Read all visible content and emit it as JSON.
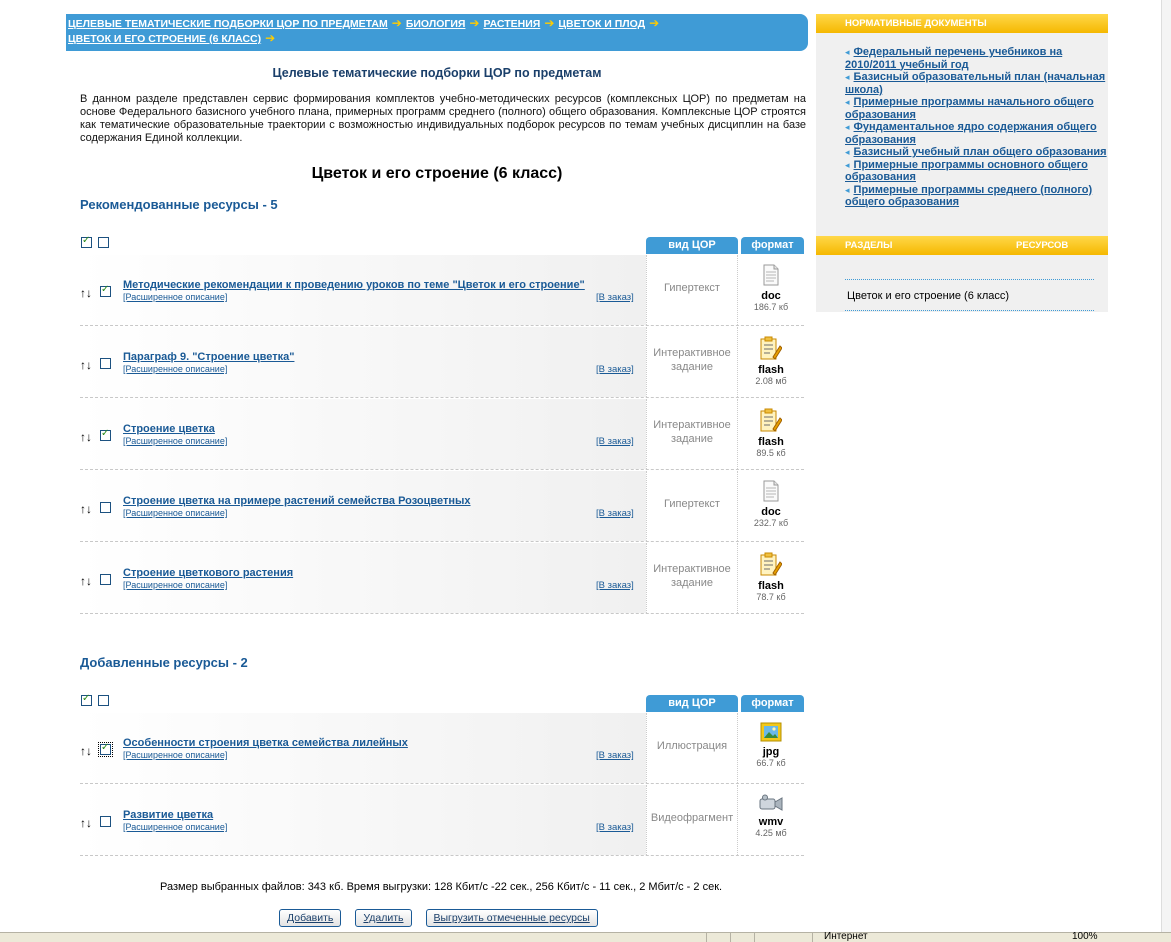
{
  "breadcrumb": {
    "items": [
      "ЦЕЛЕВЫЕ ТЕМАТИЧЕСКИЕ ПОДБОРКИ ЦОР ПО ПРЕДМЕТАМ",
      "БИОЛОГИЯ",
      "РАСТЕНИЯ",
      "ЦВЕТОК И ПЛОД",
      "ЦВЕТОК И ЕГО СТРОЕНИЕ (6 КЛАСС)"
    ]
  },
  "page_title": "Целевые тематические подборки ЦОР по предметам",
  "intro": "В данном разделе представлен сервис формирования комплектов учебно-методических ресурсов (комплексных ЦОР) по предметам на основе Федерального базисного учебного плана, примерных программ среднего (полного) общего образования. Комплексные ЦОР строятся как тематические образовательные траектории с возможностью индивидуальных подборок ресурсов по темам учебных дисциплин на базе содержания Единой коллекции.",
  "topic_title": "Цветок и его строение (6 класс)",
  "columns": {
    "kind": "вид ЦОР",
    "format": "формат"
  },
  "recommended": {
    "title": "Рекомендованные ресурсы - 5",
    "select_all_checked": true,
    "items": [
      {
        "title": "Методические рекомендации к проведению уроков по теме \"Цветок и его строение\"",
        "desc": "[Расширенное описание]",
        "order": "[В заказ]",
        "kind": "Гипертекст",
        "format": "doc",
        "size": "186.7 кб",
        "icon": "doc-icon",
        "checked": true
      },
      {
        "title": "Параграф 9. \"Строение цветка\"",
        "desc": "[Расширенное описание]",
        "order": "[В заказ]",
        "kind": "Интерактивное задание",
        "format": "flash",
        "size": "2.08 мб",
        "icon": "flash-icon",
        "checked": false
      },
      {
        "title": "Строение цветка",
        "desc": "[Расширенное описание]",
        "order": "[В заказ]",
        "kind": "Интерактивное задание",
        "format": "flash",
        "size": "89.5 кб",
        "icon": "flash-icon",
        "checked": true
      },
      {
        "title": "Строение цветка на примере растений семейства Розоцветных",
        "desc": "[Расширенное описание]",
        "order": "[В заказ]",
        "kind": "Гипертекст",
        "format": "doc",
        "size": "232.7 кб",
        "icon": "doc-icon",
        "checked": false
      },
      {
        "title": "Строение цветкового растения",
        "desc": "[Расширенное описание]",
        "order": "[В заказ]",
        "kind": "Интерактивное задание",
        "format": "flash",
        "size": "78.7 кб",
        "icon": "flash-icon",
        "checked": false
      }
    ]
  },
  "added": {
    "title": "Добавленные ресурсы - 2",
    "select_all_checked": true,
    "items": [
      {
        "title": "Особенности строения цветка семейства лилейных",
        "desc": "[Расширенное описание]",
        "order": "[В заказ]",
        "kind": "Иллюстрация",
        "format": "jpg",
        "size": "66.7 кб",
        "icon": "image-icon",
        "checked": true
      },
      {
        "title": "Развитие цветка",
        "desc": "[Расширенное описание]",
        "order": "[В заказ]",
        "kind": "Видеофрагмент",
        "format": "wmv",
        "size": "4.25 мб",
        "icon": "video-camera-icon",
        "checked": false
      }
    ]
  },
  "summary": "Размер выбранных файлов: 343 кб. Время выгрузки: 128 Кбит/с -22 сек., 256 Кбит/с - 11 сек., 2 Мбит/с - 2 сек.",
  "buttons": {
    "add": "Добавить",
    "delete": "Удалить",
    "export": "Выгрузить отмеченные ресурсы"
  },
  "sidebar": {
    "norm_title": "НОРМАТИВНЫЕ ДОКУМЕНТЫ",
    "norm_items": [
      "Федеральный перечень учебников на 2010/2011 учебный год",
      "Базисный образовательный план (начальная школа)",
      "Примерные программы начального общего образования",
      "Фундаментальное ядро содержания общего образования",
      "Базисный учебный план общего образования",
      "Примерные программы основного общего образования",
      "Примерные программы среднего (полного) общего образования"
    ],
    "sections_title_a": "РАЗДЕЛЫ",
    "sections_title_b": "РЕСУРСОВ",
    "section_item": "Цветок и его строение (6 класс)"
  },
  "statusbar": {
    "zone": "Интернет",
    "zoom": "100%"
  },
  "colors": {
    "accent_blue": "#3f9bd6",
    "link": "#1a5a96",
    "sidebar_yellow": "#f5b800",
    "arrow_yellow": "#ffcc00"
  }
}
